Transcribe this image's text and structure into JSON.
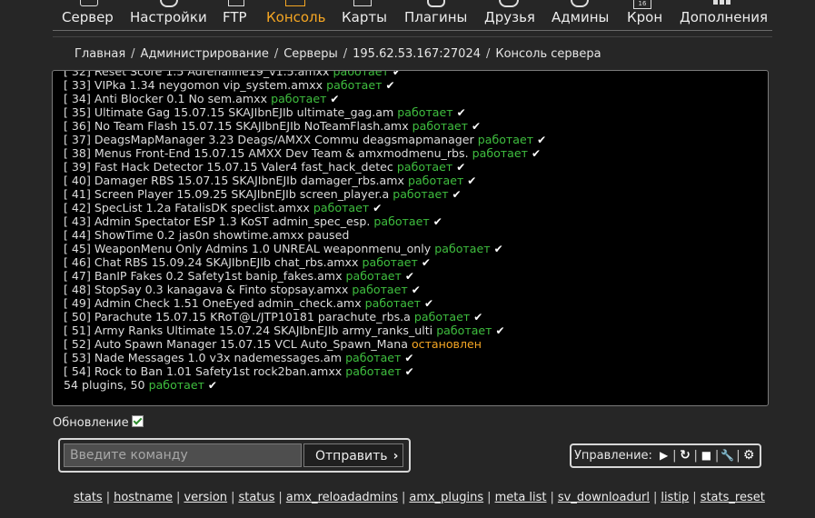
{
  "nav": {
    "items": [
      {
        "label": "Сервер",
        "active": false
      },
      {
        "label": "Настройки",
        "active": false
      },
      {
        "label": "FTP",
        "active": false
      },
      {
        "label": "Консоль",
        "active": true
      },
      {
        "label": "Карты",
        "active": false
      },
      {
        "label": "Плагины",
        "active": false
      },
      {
        "label": "Друзья",
        "active": false
      },
      {
        "label": "Админы",
        "active": false
      },
      {
        "label": "Крон",
        "active": false
      },
      {
        "label": "Дополнения",
        "active": false
      }
    ],
    "cron_badge": "16"
  },
  "breadcrumb": [
    "Главная",
    "Администрирование",
    "Серверы",
    "195.62.53.167:27024",
    "Консоль сервера"
  ],
  "console": {
    "lines": [
      {
        "text": "[ 32] Reset Score 1.5 Adrenaline19_v1.5.amxx",
        "status": "работает",
        "type": "ok"
      },
      {
        "text": "[ 33] VIPka 1.34 neygomon vip_system.amxx",
        "status": "работает",
        "type": "ok"
      },
      {
        "text": "[ 34] Anti Blocker 0.1 No sem.amxx",
        "status": "работает",
        "type": "ok"
      },
      {
        "text": "[ 35] Ultimate Gag 15.07.15 SKAJIbnEJIb ultimate_gag.am",
        "status": "работает",
        "type": "ok"
      },
      {
        "text": "[ 36] No Team Flash 15.07.15 SKAJIbnEJIb NoTeamFlash.amx",
        "status": "работает",
        "type": "ok"
      },
      {
        "text": "[ 37] DeagsMapManager 3.23 Deags/AMXX Commu deagsmapmanager",
        "status": "работает",
        "type": "ok"
      },
      {
        "text": "[ 38] Menus Front-End 15.07.15 AMXX Dev Team & amxmodmenu_rbs.",
        "status": "работает",
        "type": "ok"
      },
      {
        "text": "[ 39] Fast Hack Detector 15.07.15 Valer4 fast_hack_detec",
        "status": "работает",
        "type": "ok"
      },
      {
        "text": "[ 40] Damager RBS 15.07.15 SKAJIbnEJIb damager_rbs.amx",
        "status": "работает",
        "type": "ok"
      },
      {
        "text": "[ 41] Screen Player 15.09.25 SKAJIbnEJIb screen_player.a",
        "status": "работает",
        "type": "ok"
      },
      {
        "text": "[ 42] SpecList 1.2a FatalisDK speclist.amxx",
        "status": "работает",
        "type": "ok"
      },
      {
        "text": "[ 43] Admin Spectator ESP 1.3 KoST admin_spec_esp.",
        "status": "работает",
        "type": "ok"
      },
      {
        "text": "[ 44] ShowTime 0.2 jas0n showtime.amxx paused",
        "status": "",
        "type": "none"
      },
      {
        "text": "[ 45] WeaponMenu Only Admins 1.0 UNREAL weaponmenu_only",
        "status": "работает",
        "type": "ok"
      },
      {
        "text": "[ 46] Chat RBS 15.09.24 SKAJIbnEJIb chat_rbs.amxx",
        "status": "работает",
        "type": "ok"
      },
      {
        "text": "[ 47] BanIP Fakes 0.2 Safety1st banip_fakes.amx",
        "status": "работает",
        "type": "ok"
      },
      {
        "text": "[ 48] StopSay 0.3 kanagava & Finto stopsay.amxx",
        "status": "работает",
        "type": "ok"
      },
      {
        "text": "[ 49] Admin Check 1.51 OneEyed admin_check.amx",
        "status": "работает",
        "type": "ok"
      },
      {
        "text": "[ 50] Parachute 15.07.15 KRoT@L/JTP10181 parachute_rbs.a",
        "status": "работает",
        "type": "ok"
      },
      {
        "text": "[ 51] Army Ranks Ultimate 15.07.24 SKAJIbnEJIb army_ranks_ulti",
        "status": "работает",
        "type": "ok"
      },
      {
        "text": "[ 52] Auto Spawn Manager 15.07.15 VCL Auto_Spawn_Mana",
        "status": "остановлен",
        "type": "stop"
      },
      {
        "text": "[ 53] Nade Messages 1.0 v3x nademessages.am",
        "status": "работает",
        "type": "ok"
      },
      {
        "text": "[ 54] Rock to Ban 1.01 Safety1st rock2ban.amxx",
        "status": "работает",
        "type": "ok"
      },
      {
        "text": "54 plugins, 50",
        "status": "работает",
        "type": "ok"
      }
    ]
  },
  "update": {
    "label": "Обновление",
    "checked": true
  },
  "command": {
    "placeholder": "Введите команду",
    "value": "",
    "send_label": "Отправить"
  },
  "control": {
    "label": "Управление:"
  },
  "quick_commands": [
    "stats",
    "hostname",
    "version",
    "status",
    "amx_reloadadmins",
    "amx_plugins",
    "meta list",
    "sv_downloadurl",
    "listip",
    "stats_reset"
  ]
}
